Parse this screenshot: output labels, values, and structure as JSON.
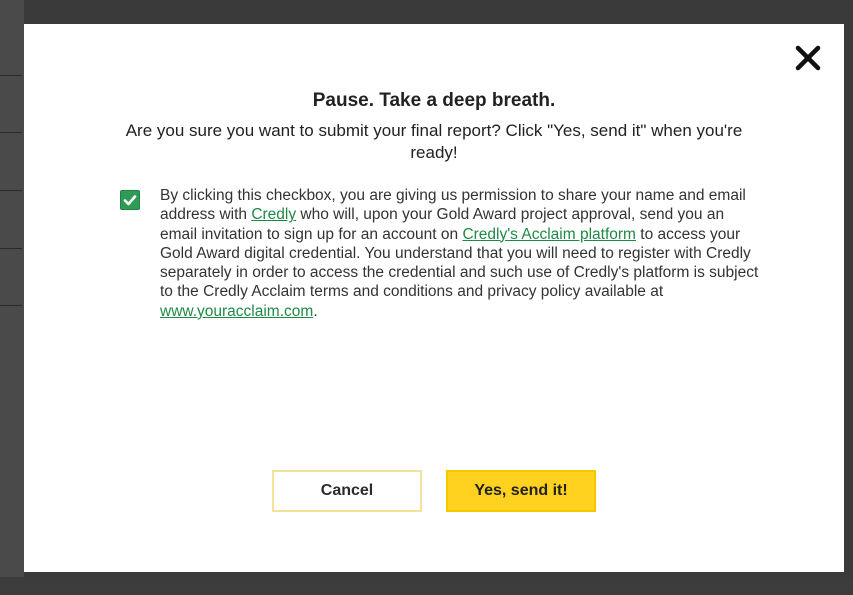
{
  "dialog": {
    "title": "Pause. Take a deep breath.",
    "question": "Are you sure you want to submit your final report?  Click \"Yes, send it\" when you're ready!",
    "close_icon": "close-icon",
    "consent": {
      "checked": true,
      "text_1": "By clicking this checkbox, you are giving us permission to share your name and email address with ",
      "link_credly": "Credly",
      "text_2": " who will, upon your Gold Award project approval, send you an email invitation to sign up for an account on ",
      "link_acclaim": "Credly's Acclaim platform",
      "text_3": " to access your Gold Award digital credential. You understand that you will need to register with Credly separately in order to access the credential and such use of Credly's platform is subject to the Credly Acclaim terms and conditions and privacy policy available at ",
      "link_site": "www.youracclaim.com",
      "text_4": "."
    },
    "buttons": {
      "cancel_label": "Cancel",
      "confirm_label": "Yes, send it!"
    }
  },
  "colors": {
    "accent_yellow": "#ffd21f",
    "check_green": "#2f9a55",
    "link_green": "#1f8a45"
  }
}
